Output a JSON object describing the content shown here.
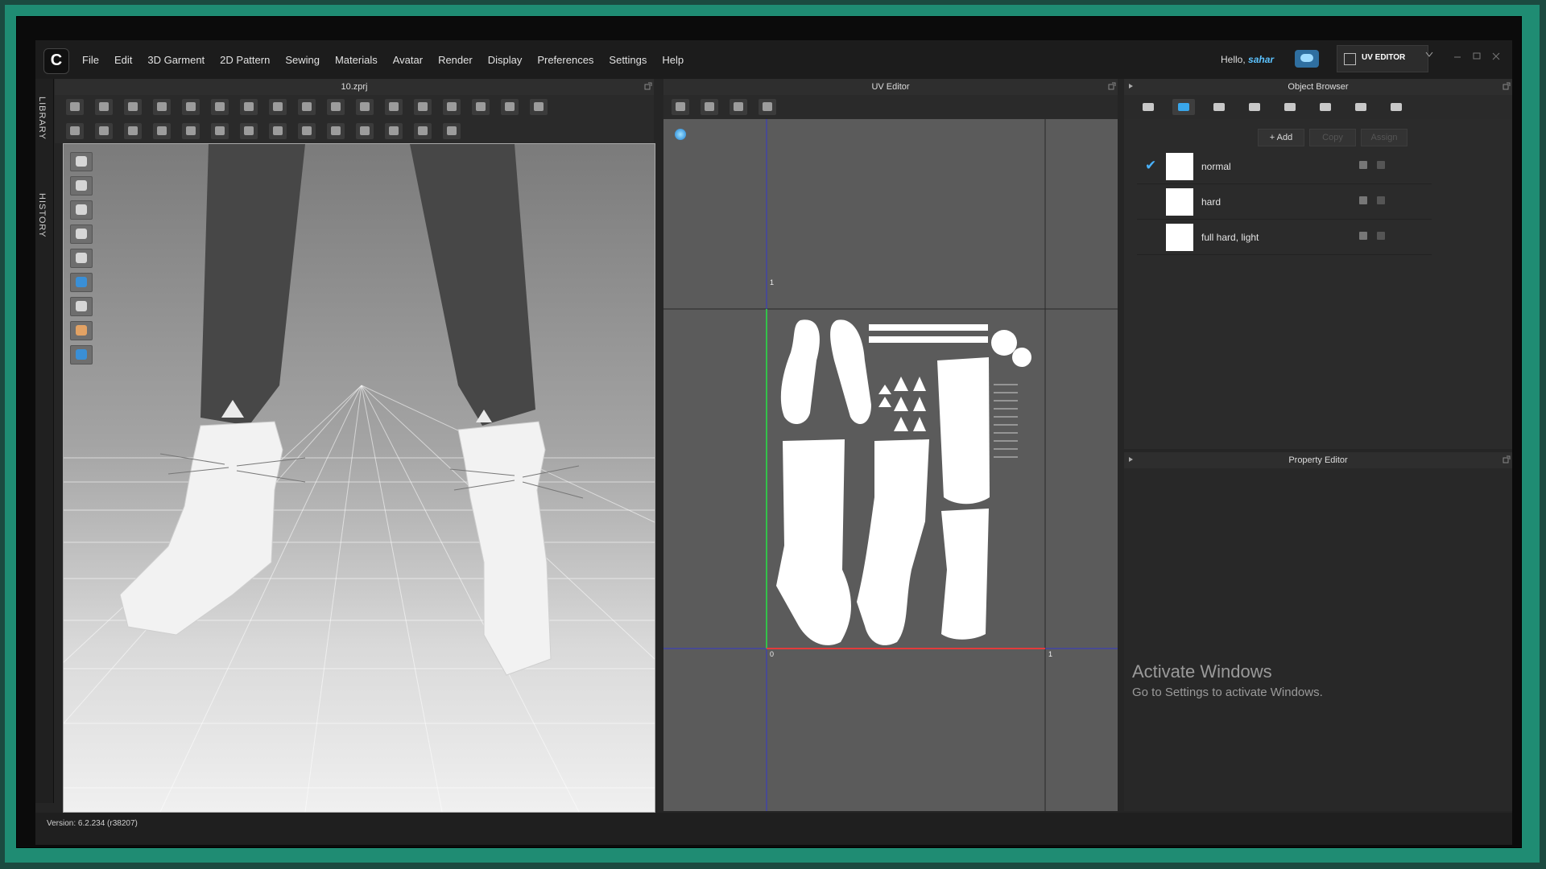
{
  "app": {
    "logo_letter": "C",
    "menu": [
      "File",
      "Edit",
      "3D Garment",
      "2D Pattern",
      "Sewing",
      "Materials",
      "Avatar",
      "Render",
      "Display",
      "Preferences",
      "Settings",
      "Help"
    ],
    "greeting": "Hello,",
    "user": "sahar",
    "mode_label": "UV EDITOR",
    "side_tabs": [
      "LIBRARY",
      "HISTORY"
    ],
    "version": "Version: 6.2.234 (r38207)"
  },
  "viewport": {
    "title": "10.zprj"
  },
  "uv_editor": {
    "title": "UV Editor",
    "axis_labels": {
      "top_one": "1",
      "origin": "0",
      "right_one": "1"
    },
    "colors": {
      "x_axis": "#e33b3b",
      "y_axis": "#33c24a",
      "grid": "#3438c8"
    }
  },
  "object_browser": {
    "title": "Object Browser",
    "add_label": "+ Add",
    "copy_label": "Copy",
    "assign_label": "Assign",
    "materials": [
      {
        "name": "normal",
        "checked": true
      },
      {
        "name": "hard",
        "checked": false
      },
      {
        "name": "full hard, light",
        "checked": false
      }
    ]
  },
  "property_editor": {
    "title": "Property Editor"
  },
  "watermark": {
    "title": "Activate Windows",
    "subtitle": "Go to Settings to activate Windows."
  }
}
